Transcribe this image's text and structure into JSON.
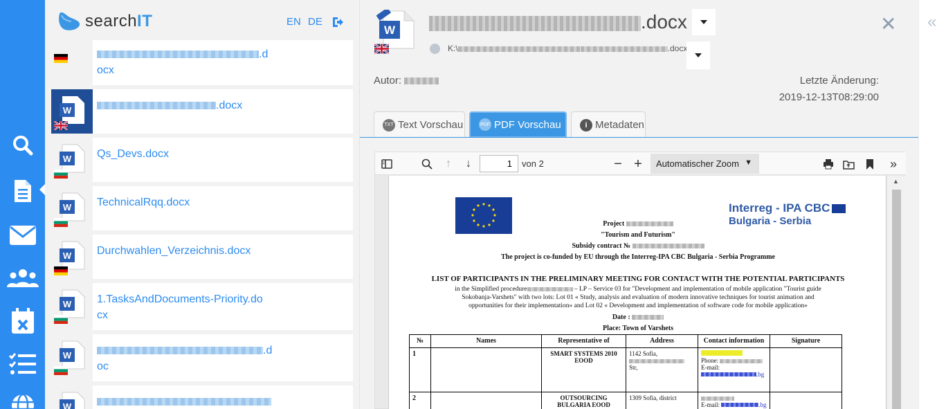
{
  "brand": {
    "name_prefix": "search",
    "name_suffix": "IT"
  },
  "languages": [
    "EN",
    "DE"
  ],
  "nav": [
    "search-icon",
    "document-icon",
    "mail-icon",
    "users-icon",
    "calendar-x-icon",
    "checklist-icon",
    "globe-icon"
  ],
  "results": [
    {
      "name": "(redacted).docx",
      "shown": ".d",
      "shown2": "ocx",
      "flag": "de",
      "active": false
    },
    {
      "name": "(redacted).docx",
      "shown": ".docx",
      "flag": "gb",
      "active": true
    },
    {
      "name": "Qs_Devs.docx",
      "flag": "bg",
      "active": false
    },
    {
      "name": "TechnicalRqq.docx",
      "flag": "bg",
      "active": false
    },
    {
      "name": "Durchwahlen_Verzeichnis.docx",
      "flag": "de",
      "active": false
    },
    {
      "name_line1": "1.TasksAndDocuments-Priority.do",
      "name_line2": "cx",
      "flag": "bg",
      "active": false
    },
    {
      "shown": ".d",
      "shown2": "oc",
      "flag": "bg",
      "active": false
    }
  ],
  "detail": {
    "title_suffix": ".docx",
    "path_prefix": "K:\\",
    "path_suffix": ".docx",
    "autor_label": "Autor:",
    "modified_label": "Letzte Änderung:",
    "modified_value": "2019-12-13T08:29:00",
    "tabs": [
      {
        "label": "Text Vorschau",
        "icon": "TXT",
        "active": false
      },
      {
        "label": "PDF Vorschau",
        "icon": "PDF",
        "active": true
      },
      {
        "label": "Metadaten",
        "icon": "i",
        "active": false
      }
    ]
  },
  "viewer": {
    "page": "1",
    "page_of": "von 2",
    "zoom": "Automatischer Zoom"
  },
  "pdf": {
    "project_label": "Project",
    "project_name": "\"Tourism and Futurism\"",
    "subsidy": "Subsidy contract №",
    "cofunded": "The project is co-funded by EU through the Interreg-IPA CBC Bulgaria - Serbia Programme",
    "interreg_line1": "Interreg - IPA CBC",
    "interreg_line2": "Bulgaria - Serbia",
    "list_title": "LIST OF PARTICIPANTS IN THE PRELIMINARY MEETING FOR CONTACT WITH THE POTENTIAL PARTICIPANTS",
    "proc_a": "in the Simplified procedure",
    "proc_b": "– LP – Service 03 for \"Development and implementation of mobile application \"Tourist guide",
    "proc_c": "Sokobanja-Varshets\" with two lots: Lot 01 « Study, analysis and evaluation of modern innovative techniques for tourist animation and",
    "proc_d": "opportunities for their implementation» and Lot 02 « Development and implementation of software code for mobile application»",
    "date_label": "Date :",
    "place": "Place: Town of Varshets",
    "table_headers": [
      "№",
      "Names",
      "Representative  of",
      "Address",
      "Contact information",
      "Signature"
    ],
    "rows": [
      {
        "no": "1",
        "rep": "SMART SYSTEMS 2010 EOOD",
        "addr1": "1142 Sofia,",
        "addr2": "Str,",
        "phone": "Phone:",
        "email": "E-mail:",
        "domain": ".bg"
      },
      {
        "no": "2",
        "rep": "OUTSOURCING BULGARIA EOOD",
        "addr1": "1309 Sofia, district",
        "email": "E-mail:",
        "domain": ".bg"
      }
    ]
  },
  "colors": {
    "rail": "#2d8cf0",
    "accent": "#3b97e3",
    "active_thumb": "#1f4e96",
    "link": "#2d8cf0"
  }
}
